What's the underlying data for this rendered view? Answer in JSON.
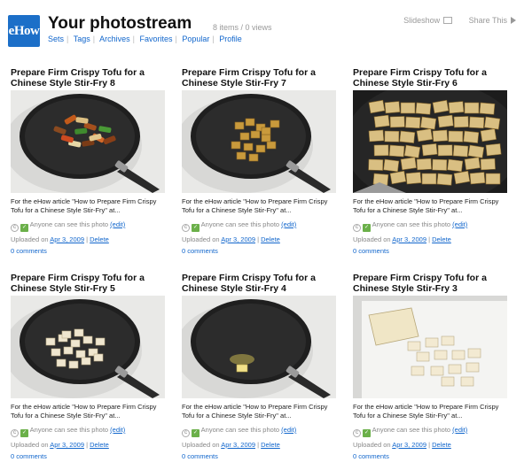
{
  "header": {
    "logo_text": "eHow",
    "title": "Your photostream",
    "stats": "8 items / 0 views",
    "nav": [
      "Sets",
      "Tags",
      "Archives",
      "Favorites",
      "Popular",
      "Profile"
    ],
    "slideshow_label": "Slideshow",
    "share_label": "Share This"
  },
  "common": {
    "description": "For the eHow article \"How to Prepare Firm Crispy Tofu for a Chinese Style Stir-Fry\" at...",
    "permission_text": "Anyone can see this photo",
    "edit_label": "(edit)",
    "uploaded_prefix": "Uploaded on",
    "delete_label": "Delete",
    "comments_label": "0 comments"
  },
  "photos": [
    {
      "title": "Prepare Firm Crispy Tofu for a Chinese Style Stir-Fry 8",
      "date": "Apr 3, 2009",
      "scene": "wok-veg"
    },
    {
      "title": "Prepare Firm Crispy Tofu for a Chinese Style Stir-Fry 7",
      "date": "Apr 3, 2009",
      "scene": "wok-fried"
    },
    {
      "title": "Prepare Firm Crispy Tofu for a Chinese Style Stir-Fry 6",
      "date": "Apr 3, 2009",
      "scene": "closeup"
    },
    {
      "title": "Prepare Firm Crispy Tofu for a Chinese Style Stir-Fry 5",
      "date": "Apr 3, 2009",
      "scene": "wok-raw"
    },
    {
      "title": "Prepare Firm Crispy Tofu for a Chinese Style Stir-Fry 4",
      "date": "Apr 3, 2009",
      "scene": "wok-oil"
    },
    {
      "title": "Prepare Firm Crispy Tofu for a Chinese Style Stir-Fry 3",
      "date": "Apr 3, 2009",
      "scene": "board"
    }
  ],
  "colors": {
    "link": "#1166cc",
    "logo_bg": "#1c6fc8",
    "permission_icon": "#6bb04a"
  }
}
